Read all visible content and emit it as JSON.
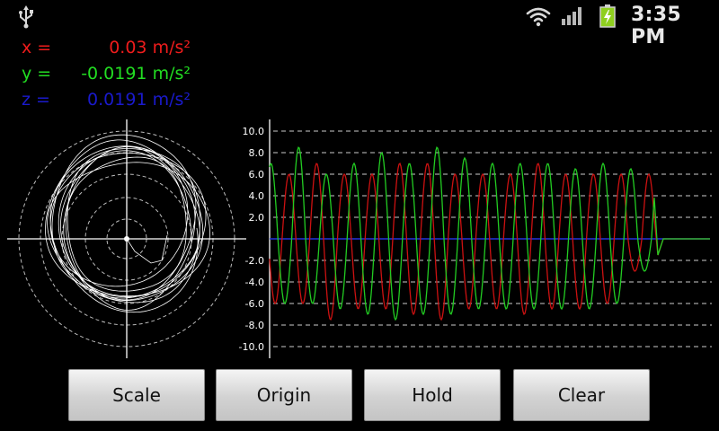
{
  "status_bar": {
    "time": "3:35 PM",
    "icons": [
      "usb-icon",
      "wifi-icon",
      "signal-icon",
      "battery-charging-icon"
    ]
  },
  "readings": {
    "x": {
      "label": "x =",
      "value": "0.03 m/s²",
      "color": "#ee1c1c"
    },
    "y": {
      "label": "y =",
      "value": "-0.0191 m/s²",
      "color": "#22dd22"
    },
    "z": {
      "label": "z =",
      "value": "0.0191 m/s²",
      "color": "#1a1acc"
    }
  },
  "chart_data": {
    "type": "line",
    "y_ticks": [
      "10.0",
      "8.0",
      "6.0",
      "4.0",
      "2.0",
      "-2.0",
      "-4.0",
      "-6.0",
      "-8.0",
      "-10.0"
    ],
    "ylim": [
      -10,
      10
    ],
    "grid": true,
    "series": [
      {
        "color": "#cc1111",
        "peaks": [
          6.0,
          6.0,
          7.0,
          6.0,
          6.0,
          7.0,
          7.0,
          6.0,
          6.0,
          6.0,
          7.0,
          6.0,
          6.0,
          6.0
        ],
        "troughs": [
          -6.0,
          -6.0,
          -7.5,
          -6.5,
          -6.5,
          -7.0,
          -7.5,
          -6.5,
          -6.5,
          -7.0,
          -6.5,
          -6.5,
          -6.0,
          -3.0
        ]
      },
      {
        "color": "#22cc22",
        "peaks": [
          7.0,
          8.5,
          6.0,
          7.0,
          8.0,
          7.0,
          8.5,
          7.5,
          7.0,
          7.0,
          7.0,
          6.5,
          7.0,
          6.5
        ],
        "troughs": [
          -6.0,
          -6.0,
          -6.5,
          -7.0,
          -7.5,
          -7.0,
          -7.0,
          -6.5,
          -6.5,
          -6.5,
          -6.5,
          -6.5,
          -6.0,
          -3.0
        ]
      },
      {
        "color": "#2233dd",
        "values": [
          0,
          0
        ]
      }
    ]
  },
  "buttons": {
    "scale": "Scale",
    "origin": "Origin",
    "hold": "Hold",
    "clear": "Clear"
  }
}
